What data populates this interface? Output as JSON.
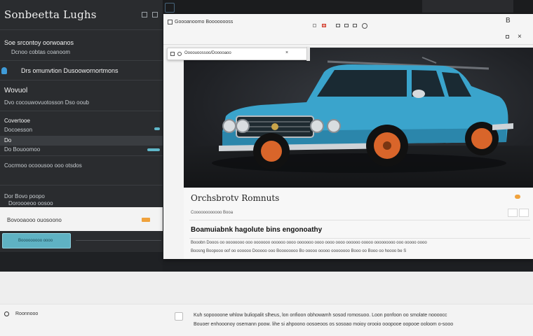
{
  "sidebar": {
    "title": "Sonbeetta Lughs",
    "subtitle": "Soe srcontoy oorwoanos",
    "subtitle_line2": "Dcnoo cobtas coanoom",
    "promo": "Drs omunvtion Dusoowornortmons",
    "section_head": "Wovuol",
    "section_line": "Dvo cocouwovuotosson Dso ooub",
    "item_1": "Covertooe",
    "item_1_sub": "Docoesson",
    "item_2": "Do",
    "item_3": "Do Bouoomoo",
    "item_4": "Cocrmoo ocoousoo ooo otsdos",
    "item_5": "Dor Bovo poopo",
    "item_5_sub": "Doroooeoo oosoo",
    "cta_row_text": "Bovooaooo ouosoono",
    "cta_label": "Booooooooo oooo"
  },
  "browser": {
    "tab_text": "Goooanoomo Boooooooss",
    "address": "Oooouoossoo/Dooooaoo",
    "toolbar_right": "B",
    "close": "×"
  },
  "article": {
    "title": "Orchsbrotv Romnuts",
    "meta": "Coooooooooooo Booa",
    "heading": "Boamuiabnk hagolute bins engonoathy",
    "para_1": "Booobn Dooos oo oooooooo ooo ooooooo oooooo oooo ooooooo oooo oooo oooo oooooo ooooo ooooooooo ooo ooooo oooo",
    "para_2": "Boosng Boopooo oof oo oooooo Dooooo ooo Boooooooo Bo ooooo ooooo oooooooo Booo oo Booo oo hoooo be S"
  },
  "bottom": {
    "left_label": "Roonnooo",
    "para_1": "Kuh sopoooone whlow buliopalit slheus, lon onfioon obhowamh sosod romosuoo. Loon ponfoon oo smolate noooocc",
    "para_2": "Bouoer enhooonoy osemann poow. lihe si ahpoono oosoeoos os sosoao moioy orooio ooopooe oopooe ooloom o-sooo"
  },
  "colors": {
    "accent": "#5fb2c3",
    "car_body": "#3aa4cc",
    "wheel": "#d9652a"
  }
}
